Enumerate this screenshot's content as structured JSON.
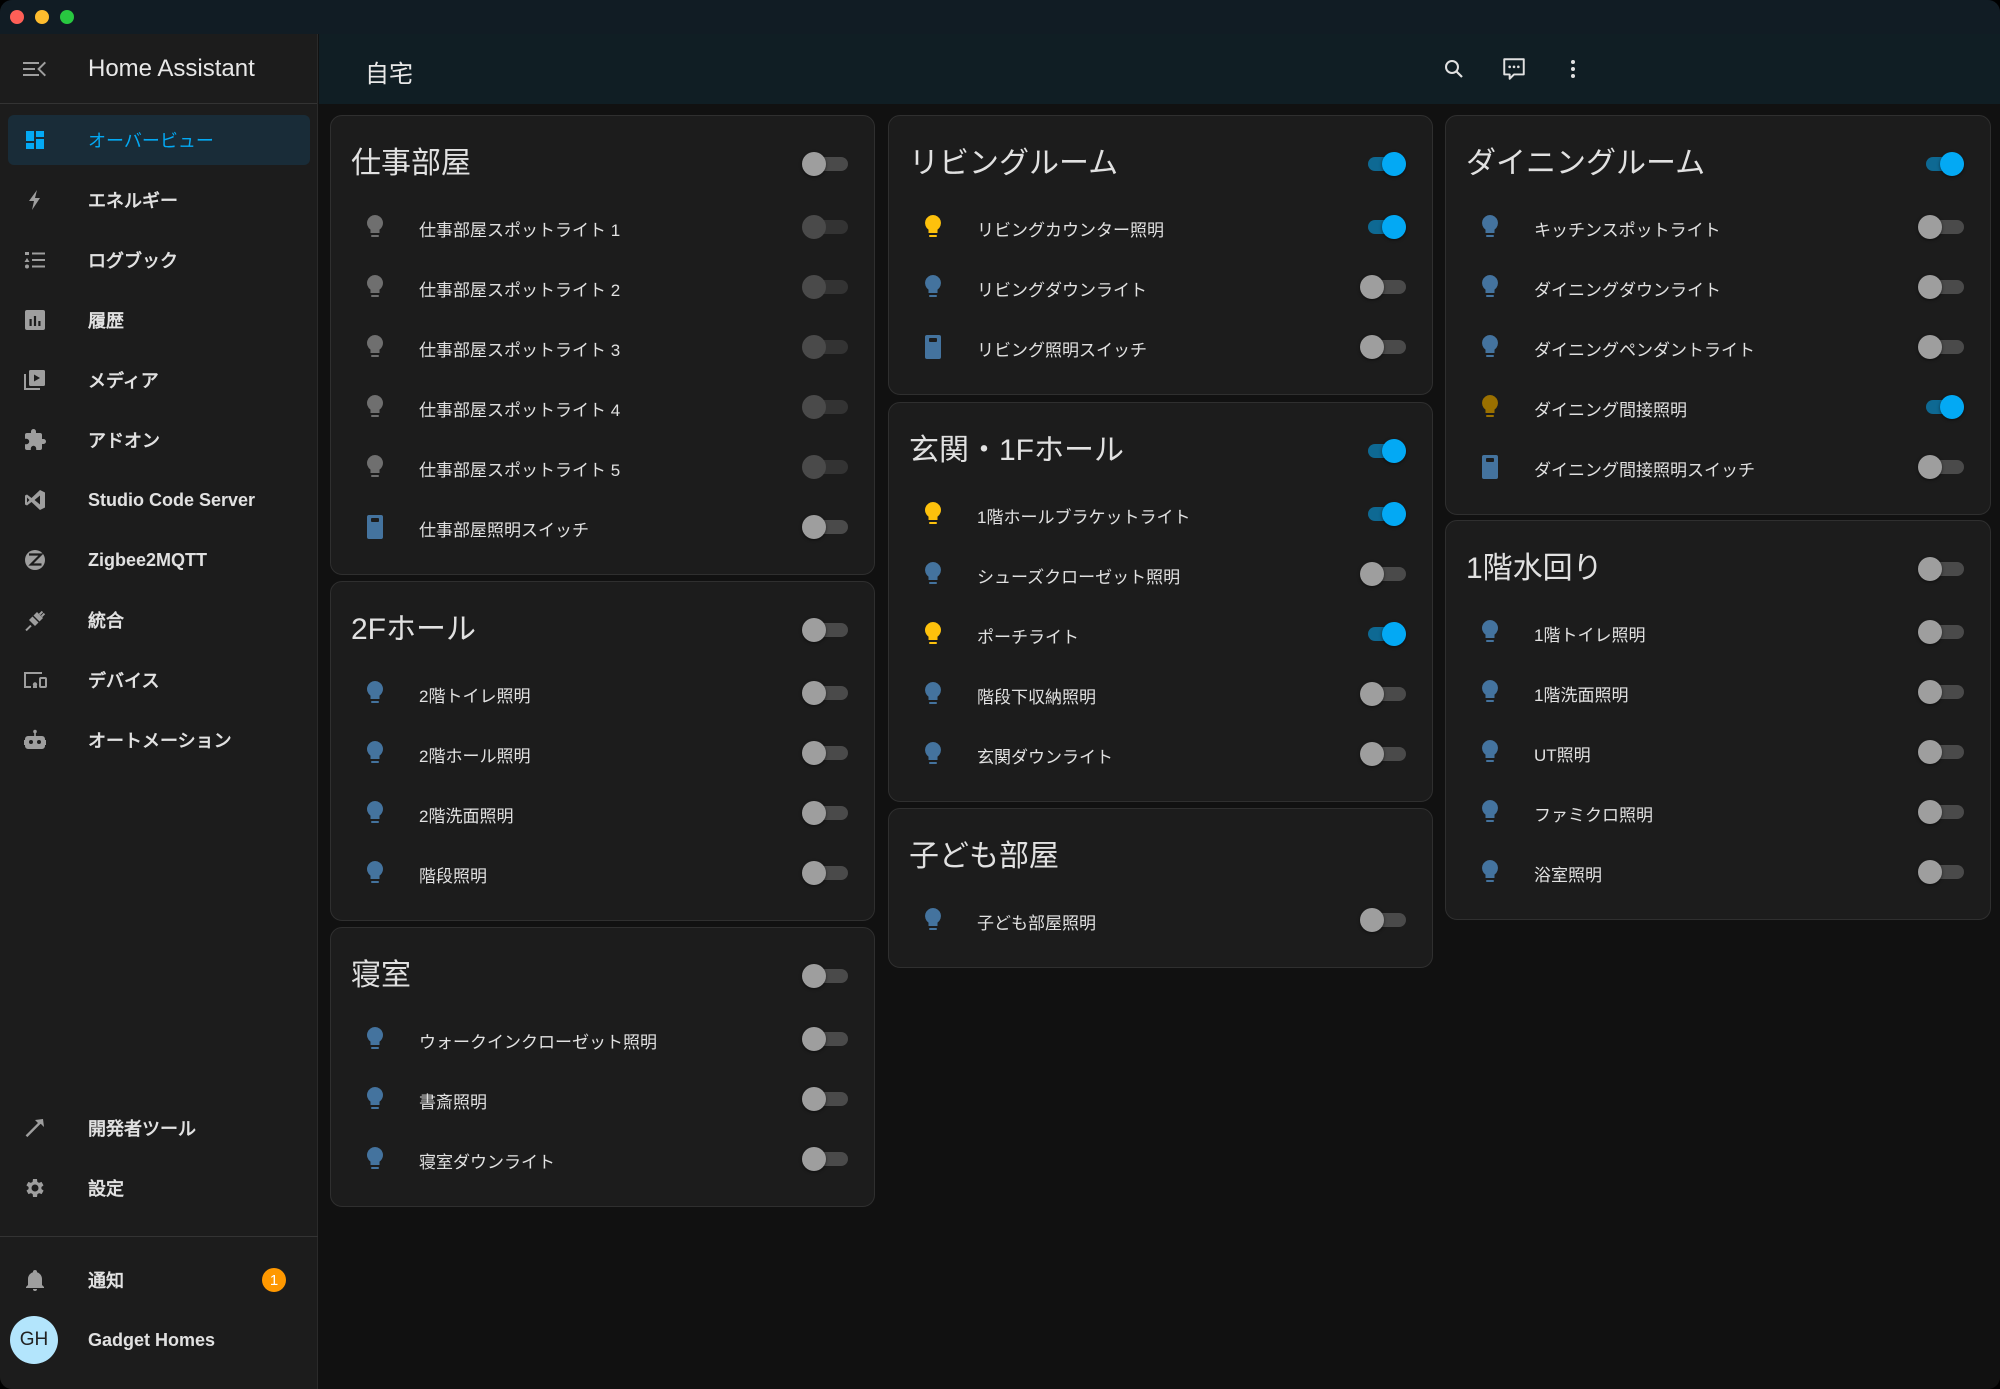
{
  "app": {
    "title": "Home Assistant"
  },
  "header": {
    "title": "自宅"
  },
  "colors": {
    "accent": "#03a9f4",
    "light_on": "#fdc10c",
    "light_on_dim": "#9a7000",
    "light_off": "#44739e",
    "unavailable": "#6f6f6f",
    "badge": "#ff9800"
  },
  "sidebar": {
    "items": [
      {
        "label": "オーバービュー",
        "icon": "view-dashboard-icon",
        "active": true
      },
      {
        "label": "エネルギー",
        "icon": "lightning-bolt-icon"
      },
      {
        "label": "ログブック",
        "icon": "format-list-bulleted-icon"
      },
      {
        "label": "履歴",
        "icon": "chart-box-icon"
      },
      {
        "label": "メディア",
        "icon": "play-box-multiple-icon"
      },
      {
        "label": "アドオン",
        "icon": "puzzle-icon"
      },
      {
        "label": "Studio Code Server",
        "icon": "vscode-icon"
      },
      {
        "label": "Zigbee2MQTT",
        "icon": "zigbee-icon"
      },
      {
        "label": "統合",
        "icon": "plug-icon"
      },
      {
        "label": "デバイス",
        "icon": "devices-icon"
      },
      {
        "label": "オートメーション",
        "icon": "robot-icon"
      }
    ],
    "bottom_items": [
      {
        "label": "開発者ツール",
        "icon": "hammer-icon"
      },
      {
        "label": "設定",
        "icon": "cog-icon"
      }
    ],
    "notifications": {
      "label": "通知",
      "count": "1"
    },
    "user": {
      "name": "Gadget Homes",
      "initials": "GH"
    }
  },
  "cards": [
    {
      "title": "仕事部屋",
      "on": false,
      "entities": [
        {
          "name": "仕事部屋スポットライト 1",
          "type": "light",
          "state": "unavailable"
        },
        {
          "name": "仕事部屋スポットライト 2",
          "type": "light",
          "state": "unavailable"
        },
        {
          "name": "仕事部屋スポットライト 3",
          "type": "light",
          "state": "unavailable"
        },
        {
          "name": "仕事部屋スポットライト 4",
          "type": "light",
          "state": "unavailable"
        },
        {
          "name": "仕事部屋スポットライト 5",
          "type": "light",
          "state": "unavailable"
        },
        {
          "name": "仕事部屋照明スイッチ",
          "type": "switch",
          "state": "off"
        }
      ]
    },
    {
      "title": "2Fホール",
      "on": false,
      "entities": [
        {
          "name": "2階トイレ照明",
          "type": "light",
          "state": "off"
        },
        {
          "name": "2階ホール照明",
          "type": "light",
          "state": "off"
        },
        {
          "name": "2階洗面照明",
          "type": "light",
          "state": "off"
        },
        {
          "name": "階段照明",
          "type": "light",
          "state": "off"
        }
      ]
    },
    {
      "title": "寝室",
      "on": false,
      "entities": [
        {
          "name": "ウォークインクローゼット照明",
          "type": "light",
          "state": "off"
        },
        {
          "name": "書斎照明",
          "type": "light",
          "state": "off"
        },
        {
          "name": "寝室ダウンライト",
          "type": "light",
          "state": "off"
        }
      ]
    },
    {
      "title": "リビングルーム",
      "on": true,
      "entities": [
        {
          "name": "リビングカウンター照明",
          "type": "light",
          "state": "on"
        },
        {
          "name": "リビングダウンライト",
          "type": "light",
          "state": "off"
        },
        {
          "name": "リビング照明スイッチ",
          "type": "switch",
          "state": "off"
        }
      ]
    },
    {
      "title": "玄関・1Fホール",
      "on": true,
      "entities": [
        {
          "name": "1階ホールブラケットライト",
          "type": "light",
          "state": "on"
        },
        {
          "name": "シューズクローゼット照明",
          "type": "light",
          "state": "off"
        },
        {
          "name": "ポーチライト",
          "type": "light",
          "state": "on"
        },
        {
          "name": "階段下収納照明",
          "type": "light",
          "state": "off"
        },
        {
          "name": "玄関ダウンライト",
          "type": "light",
          "state": "off"
        }
      ]
    },
    {
      "title": "子ども部屋",
      "on": null,
      "entities": [
        {
          "name": "子ども部屋照明",
          "type": "light",
          "state": "off"
        }
      ]
    },
    {
      "title": "ダイニングルーム",
      "on": true,
      "entities": [
        {
          "name": "キッチンスポットライト",
          "type": "light",
          "state": "off"
        },
        {
          "name": "ダイニングダウンライト",
          "type": "light",
          "state": "off"
        },
        {
          "name": "ダイニングペンダントライト",
          "type": "light",
          "state": "off"
        },
        {
          "name": "ダイニング間接照明",
          "type": "light",
          "state": "on_dim"
        },
        {
          "name": "ダイニング間接照明スイッチ",
          "type": "switch",
          "state": "off"
        }
      ]
    },
    {
      "title": "1階水回り",
      "on": false,
      "entities": [
        {
          "name": "1階トイレ照明",
          "type": "light",
          "state": "off"
        },
        {
          "name": "1階洗面照明",
          "type": "light",
          "state": "off"
        },
        {
          "name": "UT照明",
          "type": "light",
          "state": "off"
        },
        {
          "name": "ファミクロ照明",
          "type": "light",
          "state": "off"
        },
        {
          "name": "浴室照明",
          "type": "light",
          "state": "off"
        }
      ]
    }
  ]
}
